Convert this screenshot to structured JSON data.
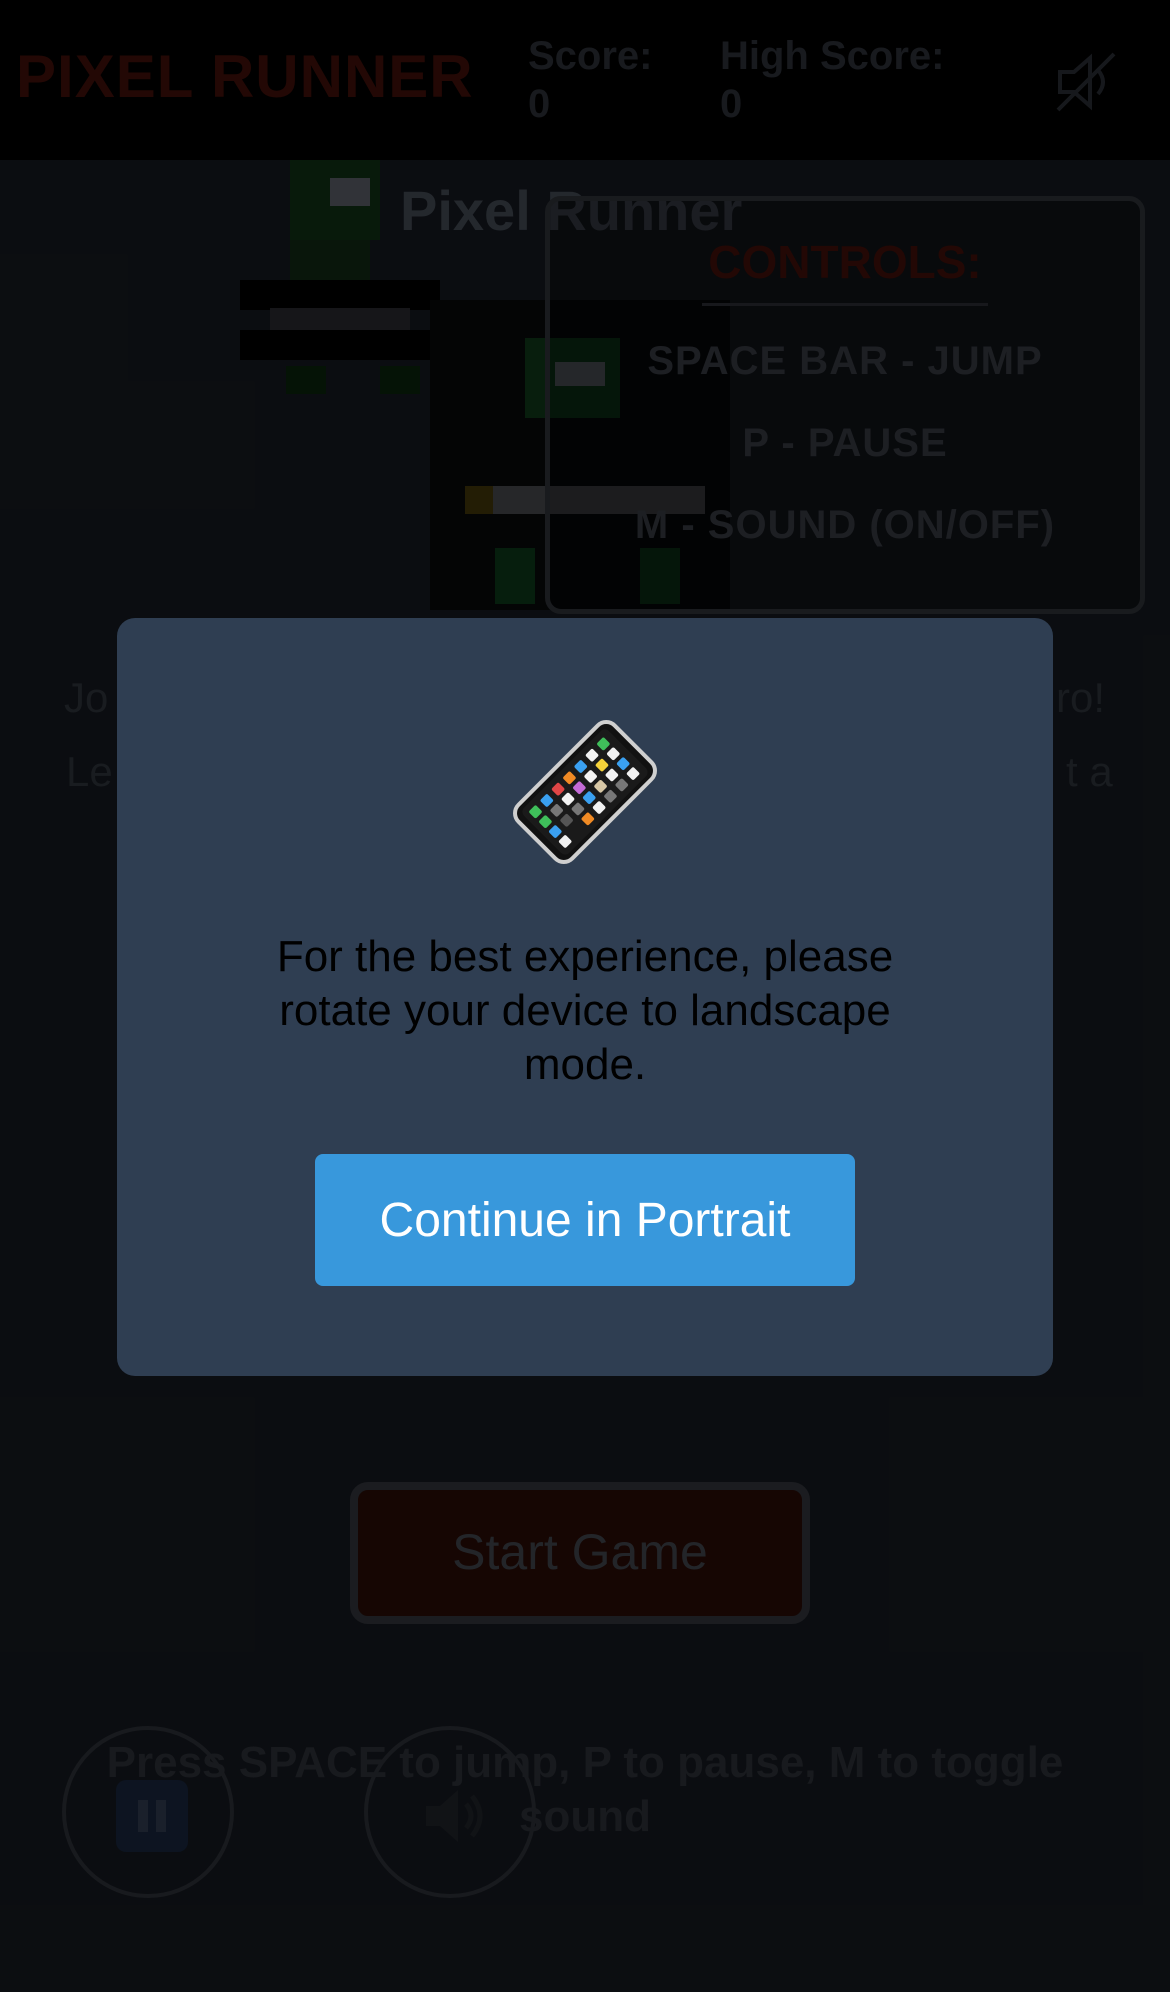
{
  "header": {
    "game_title": "PIXEL RUNNER",
    "score_label": "Score:",
    "score_value": "0",
    "high_score_label": "High Score:",
    "high_score_value": "0",
    "mute_icon": "speaker-muted-icon"
  },
  "main": {
    "heading": "Pixel Runner",
    "intro_line_1_start": "Jo",
    "intro_line_1_end": "ro!",
    "intro_line_2_start": "Le",
    "intro_line_2_end": "t a",
    "start_button_label": "Start Game",
    "instructions": "Press SPACE to jump, P to pause, M to toggle sound"
  },
  "controls": {
    "heading": "CONTROLS:",
    "lines": [
      "SPACE BAR - JUMP",
      "P - PAUSE",
      "M - SOUND (ON/OFF)"
    ]
  },
  "bottom_controls": {
    "pause_icon": "pause-icon",
    "sound_icon": "speaker-icon"
  },
  "modal": {
    "icon": "mobile-phone-icon",
    "message": "For the best experience, please rotate your device to landscape mode.",
    "button_label": "Continue in Portrait"
  },
  "colors": {
    "modal_background": "#2f3e52",
    "button_primary": "#3898dc",
    "page_background": "#0e1014"
  }
}
